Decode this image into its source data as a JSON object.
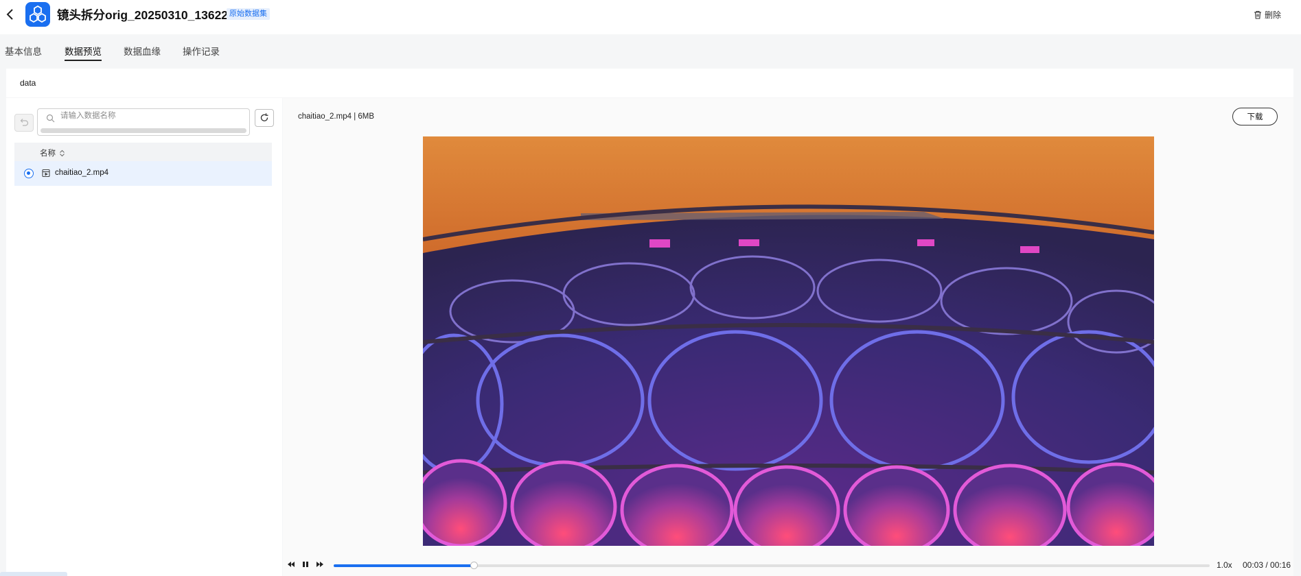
{
  "header": {
    "title": "镜头拆分orig_20250310_13622",
    "badge": "原始数据集",
    "delete_label": "删除",
    "logo_color": "#1a6ff0"
  },
  "tabs": [
    {
      "label": "基本信息",
      "active": false
    },
    {
      "label": "数据预览",
      "active": true
    },
    {
      "label": "数据血缘",
      "active": false
    },
    {
      "label": "操作记录",
      "active": false
    }
  ],
  "section": {
    "label": "data"
  },
  "file_list": {
    "search_placeholder": "请输入数据名称",
    "search_value": "",
    "column_name": "名称",
    "rows": [
      {
        "name": "chaitiao_2.mp4",
        "selected": true,
        "icon": "video-file-icon"
      }
    ]
  },
  "preview": {
    "file_info": "chaitiao_2.mp4 | 6MB",
    "download_label": "下载",
    "player": {
      "speed": "1.0x",
      "time": "00:03 / 00:16",
      "progress_fraction": 0.16,
      "state": "playing"
    }
  },
  "colors": {
    "accent": "#1a6ff0",
    "selected_row": "#eaf2fe",
    "badge_bg": "#e6effd"
  }
}
